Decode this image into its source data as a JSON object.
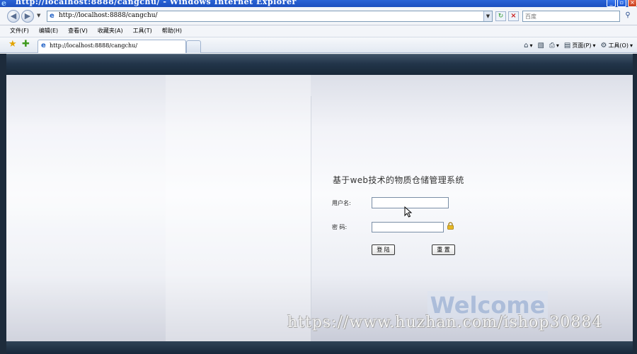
{
  "window": {
    "title": "http://localhost:8888/cangchu/ - Windows Internet Explorer"
  },
  "address_bar": {
    "url": "http://localhost:8888/cangchu/",
    "search_placeholder": "百度"
  },
  "menu": {
    "items": [
      "文件(F)",
      "编辑(E)",
      "查看(V)",
      "收藏夹(A)",
      "工具(T)",
      "帮助(H)"
    ]
  },
  "tab": {
    "label": "http://localhost:8888/cangchu/"
  },
  "toolbar": {
    "page_label": "页面(P)",
    "tools_label": "工具(O)"
  },
  "login": {
    "title": "基于web技术的物质仓储管理系统",
    "username_label": "用户名:",
    "password_label": "密 码:",
    "username_value": "",
    "password_value": "",
    "login_button": "登 陆",
    "reset_button": "重 置"
  },
  "welcome_text": "Welcome",
  "watermark": "https://www.huzhan.com/ishop30884",
  "colors": {
    "titlebar": "#2a63d6",
    "page_header": "#22354a",
    "page_bg": "#f2f3f8"
  }
}
